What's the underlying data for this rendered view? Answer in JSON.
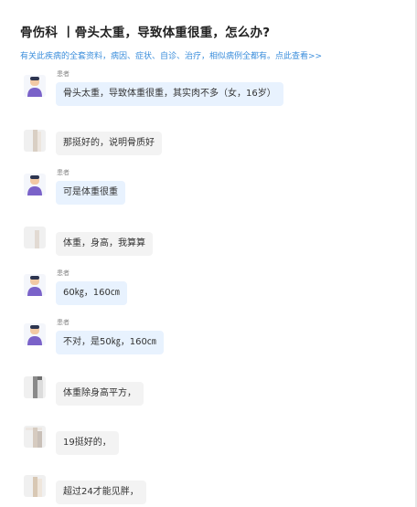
{
  "header": {
    "title": "骨伤科 丨骨头太重，导致体重很重，怎么办?",
    "subtitle": "有关此疾病的全套资料，病因、症状、自诊、治疗，相似病例全都有。点此查看>>"
  },
  "patient_label": "患者",
  "messages": [
    {
      "role": "patient",
      "text": "骨头太重，导致体重很重，其实肉不多（女，16岁）"
    },
    {
      "role": "doctor",
      "text": "那挺好的，说明骨质好"
    },
    {
      "role": "patient",
      "text": "可是体重很重"
    },
    {
      "role": "doctor",
      "text": "体重，身高，我算算"
    },
    {
      "role": "patient",
      "text": "60㎏，160㎝"
    },
    {
      "role": "patient",
      "text": "不对，是50㎏，160㎝"
    },
    {
      "role": "doctor",
      "text": "体重除身高平方，"
    },
    {
      "role": "doctor",
      "text": "19挺好的，"
    },
    {
      "role": "doctor",
      "text": "超过24才能见胖，"
    }
  ],
  "colors": {
    "patient_bubble": "#e8f2fe",
    "doctor_bubble": "#f3f3f3",
    "link": "#3d8fdc"
  }
}
